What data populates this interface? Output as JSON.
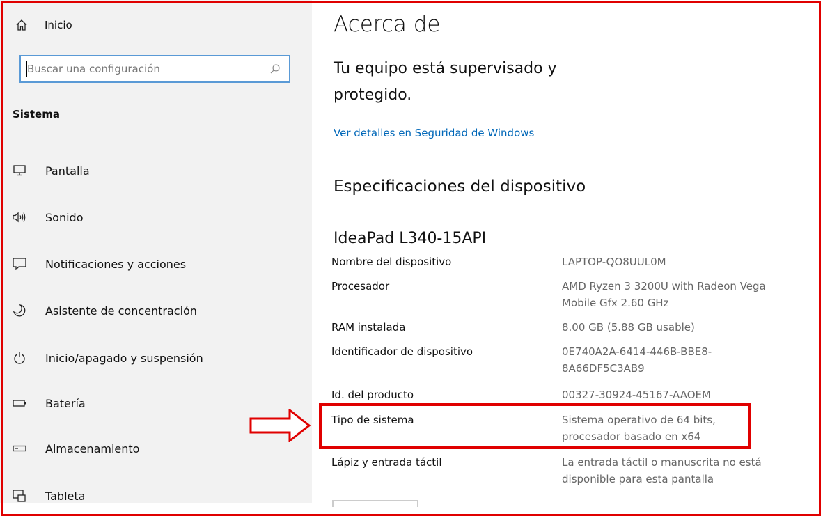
{
  "sidebar": {
    "home_label": "Inicio",
    "search_placeholder": "Buscar una configuración",
    "section_title": "Sistema",
    "items": [
      {
        "label": "Pantalla",
        "icon": "monitor-icon"
      },
      {
        "label": "Sonido",
        "icon": "speaker-icon"
      },
      {
        "label": "Notificaciones y acciones",
        "icon": "notification-icon"
      },
      {
        "label": "Asistente de concentración",
        "icon": "moon-icon"
      },
      {
        "label": "Inicio/apagado y suspensión",
        "icon": "power-icon"
      },
      {
        "label": "Batería",
        "icon": "battery-icon"
      },
      {
        "label": "Almacenamiento",
        "icon": "storage-icon"
      },
      {
        "label": "Tableta",
        "icon": "tablet-icon"
      }
    ]
  },
  "main": {
    "title": "Acerca de",
    "status": "Tu equipo está supervisado y protegido.",
    "security_link": "Ver detalles en Seguridad de Windows",
    "specs_title": "Especificaciones del dispositivo",
    "model": "IdeaPad L340-15API",
    "specs": [
      {
        "key": "Nombre del dispositivo",
        "value": "LAPTOP-QO8UUL0M"
      },
      {
        "key": "Procesador",
        "value": "AMD Ryzen 3 3200U with Radeon Vega Mobile Gfx     2.60 GHz"
      },
      {
        "key": "RAM instalada",
        "value": "8.00 GB (5.88 GB usable)"
      },
      {
        "key": "Identificador de dispositivo",
        "value": "0E740A2A-6414-446B-BBE8-8A66DF5C3AB9"
      },
      {
        "key": "Id. del producto",
        "value": "00327-30924-45167-AAOEM"
      },
      {
        "key": "Tipo de sistema",
        "value": "Sistema operativo de 64 bits, procesador basado en x64"
      },
      {
        "key": "Lápiz y entrada táctil",
        "value": "La entrada táctil o manuscrita no está disponible para esta pantalla"
      }
    ]
  },
  "colors": {
    "accent_link": "#0067b8",
    "annotation_red": "#e00000",
    "sidebar_bg": "#f2f2f2"
  }
}
